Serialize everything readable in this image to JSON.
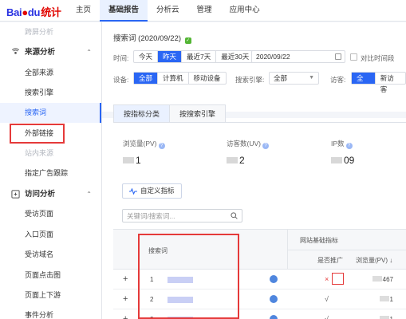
{
  "brand": {
    "logo_bai": "Bai",
    "logo_du": "du",
    "logo_stat": "统计"
  },
  "nav": [
    "主页",
    "基础报告",
    "分析云",
    "管理",
    "应用中心"
  ],
  "sidebar": {
    "top_faded": "跨屏分析",
    "group1": "来源分析",
    "items1": [
      "全部来源",
      "搜索引擎",
      "搜索词",
      "外部链接",
      "站内来源",
      "指定广告跟踪"
    ],
    "group2": "访问分析",
    "items2": [
      "受访页面",
      "入口页面",
      "受访域名",
      "页面点击图",
      "页面上下游",
      "事件分析"
    ]
  },
  "report": {
    "title": "搜索词",
    "date": "(2020/09/22)",
    "time_label": "时间:",
    "time_options": [
      "今天",
      "昨天",
      "最近7天",
      "最近30天"
    ],
    "date_value": "2020/09/22",
    "compare_label": "对比时间段",
    "device_label": "设备:",
    "device_options": [
      "全部",
      "计算机",
      "移动设备"
    ],
    "engine_label": "搜索引擎:",
    "engine_value": "全部",
    "visitor_label": "访客:",
    "visitor_options": [
      "全部",
      "新访客"
    ]
  },
  "tabs": [
    "按指标分类",
    "按搜索引擎"
  ],
  "metrics": [
    {
      "label": "浏览量(PV)",
      "value": "1"
    },
    {
      "label": "访客数(UV)",
      "value": "2"
    },
    {
      "label": "IP数",
      "value": "09"
    }
  ],
  "custom_metric": "自定义指标",
  "search_placeholder": "关键词/搜索词...",
  "table": {
    "col_keyword": "搜索词",
    "group_header": "网站基础指标",
    "col_promo": "是否推广",
    "col_pv": "浏览量(PV)",
    "rows": [
      {
        "num": "1",
        "promo": "×",
        "pv": "467"
      },
      {
        "num": "2",
        "promo": "√",
        "pv": "1"
      },
      {
        "num": "3",
        "promo": "√",
        "pv": "1"
      }
    ]
  },
  "icons": [
    "radar-icon",
    "visit-icon",
    "wave-icon",
    "search-icon",
    "help-icon"
  ],
  "colors": {
    "accent": "#2a66f4",
    "highlight": "#e53a3a",
    "brand_red": "#e10601",
    "brand_blue": "#2932e1"
  }
}
